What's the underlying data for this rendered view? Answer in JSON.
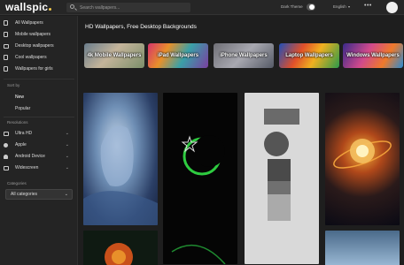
{
  "header": {
    "logo": "wallspic",
    "search_placeholder": "Search wallpapers...",
    "dark_theme_label": "Dark Theme",
    "language": "English",
    "more_label": "•••"
  },
  "sidebar": {
    "items": [
      {
        "label": "All Wallpapers"
      },
      {
        "label": "Mobile wallpapers"
      },
      {
        "label": "Desktop wallpapers"
      },
      {
        "label": "Cool wallpapers"
      },
      {
        "label": "Wallpapers for girls"
      }
    ],
    "sort_by_label": "Sort by",
    "sort_options": [
      "New",
      "Popular"
    ],
    "resolutions_label": "Resolutions",
    "resolutions": [
      {
        "label": "Ultra HD"
      },
      {
        "label": "Apple"
      },
      {
        "label": "Android Device"
      },
      {
        "label": "Widescreen"
      }
    ],
    "categories_label": "Categories",
    "categories_select": "All categories"
  },
  "main": {
    "title": "HD Wallpapers, Free Desktop Backgrounds",
    "categories": [
      {
        "label": "4k Mobile Wallpapers"
      },
      {
        "label": "iPad Wallpapers"
      },
      {
        "label": "iPhone Wallpapers"
      },
      {
        "label": "Laptop Wallpapers"
      },
      {
        "label": "Windows Wallpapers"
      }
    ]
  }
}
